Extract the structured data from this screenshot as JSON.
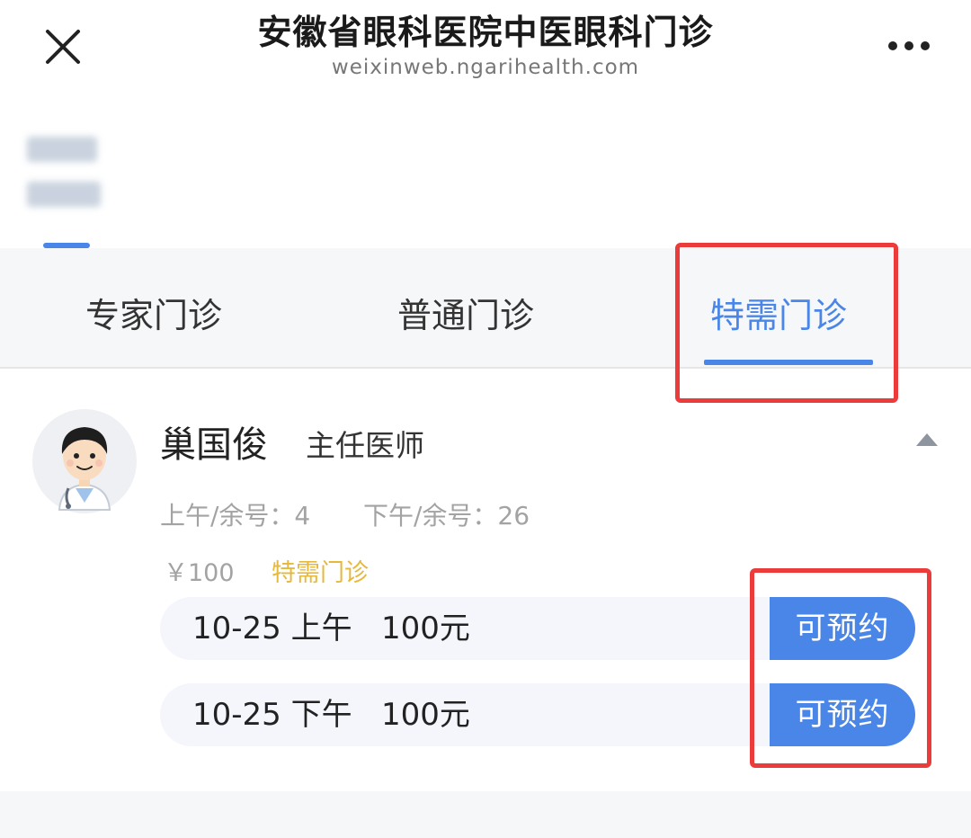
{
  "header": {
    "title": "安徽省眼科医院中医眼科门诊",
    "url": "weixinweb.ngarihealth.com",
    "close_icon": "close-icon",
    "more_icon": "more-icon"
  },
  "tabs": [
    {
      "label": "专家门诊",
      "active": false
    },
    {
      "label": "普通门诊",
      "active": false
    },
    {
      "label": "特需门诊",
      "active": true
    }
  ],
  "doctor": {
    "name": "巢国俊",
    "title": "主任医师",
    "morning_slots": "上午/余号：4",
    "afternoon_slots": "下午/余号：26",
    "price": "￥100",
    "clinic_type": "特需门诊"
  },
  "schedule": [
    {
      "label": "10-25 上午   100元",
      "button": "可预约"
    },
    {
      "label": "10-25 下午   100元",
      "button": "可预约"
    }
  ],
  "colors": {
    "accent": "#4a86e8",
    "highlight": "#ec3b3b",
    "clinic_type": "#e6b93c"
  }
}
